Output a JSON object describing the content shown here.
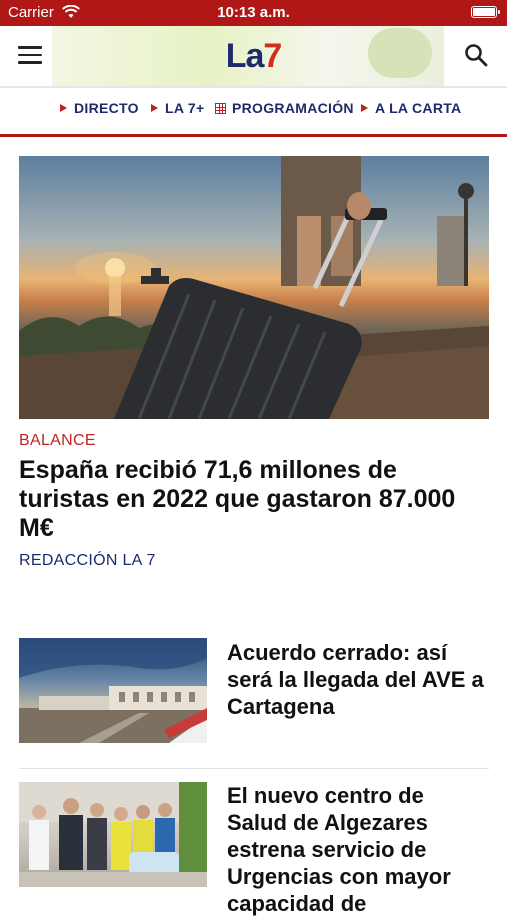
{
  "status_bar": {
    "carrier": "Carrier",
    "time": "10:13 a.m."
  },
  "header": {
    "logo_part1": "La",
    "logo_part2": "7"
  },
  "nav": [
    {
      "label": "DIRECTO",
      "icon": "play-triangle-icon"
    },
    {
      "label": "LA 7+",
      "icon": "play-triangle-icon"
    },
    {
      "label": "PROGRAMACIÓN",
      "icon": "calendar-grid-icon"
    },
    {
      "label": "A LA CARTA",
      "icon": "play-triangle-icon"
    }
  ],
  "featured": {
    "kicker": "BALANCE",
    "title": "España recibió 71,6 millones de turistas en 2022 que gastaron 87.000 M€",
    "author": "REDACCIÓN LA 7"
  },
  "articles": [
    {
      "title": "Acuerdo cerrado: así será la llegada del AVE a Cartagena"
    },
    {
      "title": "El nuevo centro de Salud de Algezares estrena servicio de Urgencias con mayor capacidad de"
    }
  ],
  "colors": {
    "brand_red": "#b01818",
    "brand_navy": "#1f2a6b",
    "kicker_red": "#c02424"
  }
}
